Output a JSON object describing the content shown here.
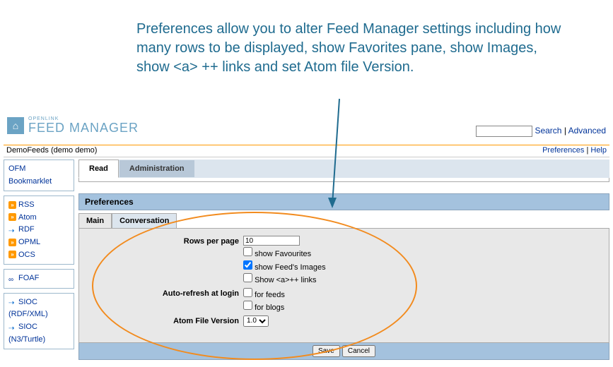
{
  "annotation_text": "Preferences allow you to alter Feed Manager settings including how many rows to be displayed, show Favorites pane, show Images, show <a> ++ links and set Atom file Version.",
  "logo": {
    "sub": "OPENLINK",
    "main": "FEED MANAGER"
  },
  "search": {
    "search_label": "Search",
    "advanced_label": "Advanced"
  },
  "userbar": {
    "user": "DemoFeeds (demo demo)",
    "preferences": "Preferences",
    "help": "Help"
  },
  "sidebar": {
    "bookmarklet": "OFM Bookmarklet",
    "feeds": [
      "RSS",
      "Atom",
      "RDF",
      "OPML",
      "OCS"
    ],
    "foaf": "FOAF",
    "sioc": [
      "SIOC (RDF/XML)",
      "SIOC (N3/Turtle)"
    ]
  },
  "tabs": {
    "read": "Read",
    "admin": "Administration"
  },
  "section_title": "Preferences",
  "subtabs": {
    "main": "Main",
    "conversation": "Conversation"
  },
  "prefs": {
    "rows_label": "Rows per page",
    "rows_value": "10",
    "show_favourites": "show Favourites",
    "show_images": "show Feed's Images",
    "show_alinks": "Show <a>++ links",
    "auto_refresh_label": "Auto-refresh at login",
    "for_feeds": "for feeds",
    "for_blogs": "for blogs",
    "atom_label": "Atom File Version",
    "atom_value": "1.0"
  },
  "buttons": {
    "save": "Save",
    "cancel": "Cancel"
  }
}
